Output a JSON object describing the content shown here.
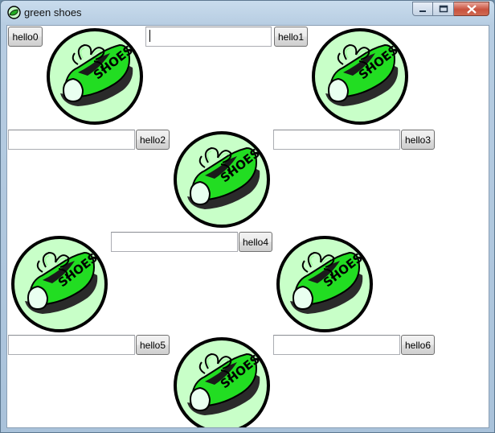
{
  "window": {
    "title": "green shoes"
  },
  "controls": {
    "minimize_icon": "minimize-icon",
    "maximize_icon": "maximize-icon",
    "close_icon": "close-icon"
  },
  "shoe_image": {
    "text": "SHOES",
    "fill": "#c8ffc8",
    "shoe_color": "#22dd22"
  },
  "buttons": [
    "hello0",
    "hello1",
    "hello2",
    "hello3",
    "hello4",
    "hello5",
    "hello6"
  ],
  "edit_lines": [
    "",
    "",
    "",
    "",
    "",
    ""
  ]
}
